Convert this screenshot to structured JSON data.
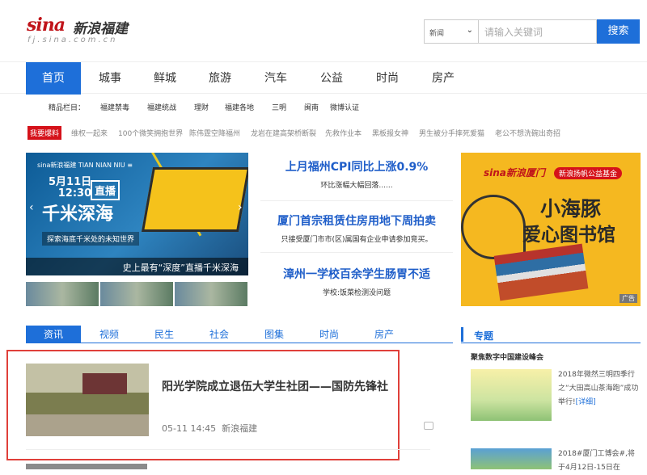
{
  "header": {
    "logo_main": "sina",
    "logo_cn": "新浪福建",
    "logo_sub": "fj.sina.com.cn",
    "search_category": "新闻",
    "search_placeholder": "请输入关键词",
    "search_button": "搜索"
  },
  "nav": {
    "items": [
      "首页",
      "城事",
      "鲜城",
      "旅游",
      "汽车",
      "公益",
      "时尚",
      "房产"
    ]
  },
  "subnav": {
    "label": "精品栏目：",
    "items": [
      "福建禁毒",
      "福建统战",
      "理财",
      "福建各地",
      "三明",
      "闽南",
      "微博认证"
    ]
  },
  "ticker": {
    "tag": "我要爆料",
    "items": [
      "维权一起来",
      "100个微笑拥抱世界",
      "陈伟霆空降福州",
      "龙岩在建高架桥断裂",
      "先救作业本",
      "黑板报女神",
      "男生被分手摔死爱猫",
      "老公不想洗碗出奇招"
    ]
  },
  "promo": {
    "logos": "sina新浪福建  TIAN NIAN NIU  ≡",
    "date": "5月11日\n12:30",
    "live": "直播",
    "big_title": "千米深海",
    "subtitle": "探索海底千米处的未知世界",
    "caption": "史上最有“深度”直播千米深海"
  },
  "headlines": [
    {
      "title": "上月福州CPI同比上涨0.9%",
      "sub": "环比涨幅大幅回落......"
    },
    {
      "title": "厦门首宗租赁住房用地下周拍卖",
      "sub": "只接受厦门市市(区)属国有企业申请参加竞买。"
    },
    {
      "title": "漳州一学校百余学生肠胃不适",
      "sub": "学校:饭菜检测没问题"
    }
  ],
  "ad": {
    "brand": "sina新浪厦门",
    "badge": "新浪扬帆公益基金",
    "line1": "小海豚",
    "line2": "爱心图书馆",
    "tag": "广告"
  },
  "tabs": [
    "资讯",
    "视频",
    "民生",
    "社会",
    "图集",
    "时尚",
    "房产"
  ],
  "news": {
    "title": "阳光学院成立退伍大学生社团——国防先锋社",
    "time": "05-11 14:45",
    "source": "新浪福建"
  },
  "sidebar": {
    "title": "专题",
    "subtitle": "聚焦数字中国建设峰会",
    "items": [
      {
        "text": "2018年微然三明四季行之“大田高山茶海跑”成功举行!",
        "more": "[详细]"
      },
      {
        "text": "2018#厦门工博会#,将于4月12日-15日在",
        "more": ""
      }
    ]
  },
  "colors": {
    "accent": "#1e6fd9",
    "brand_red": "#c0141a",
    "highlight_box": "#e0403a"
  }
}
